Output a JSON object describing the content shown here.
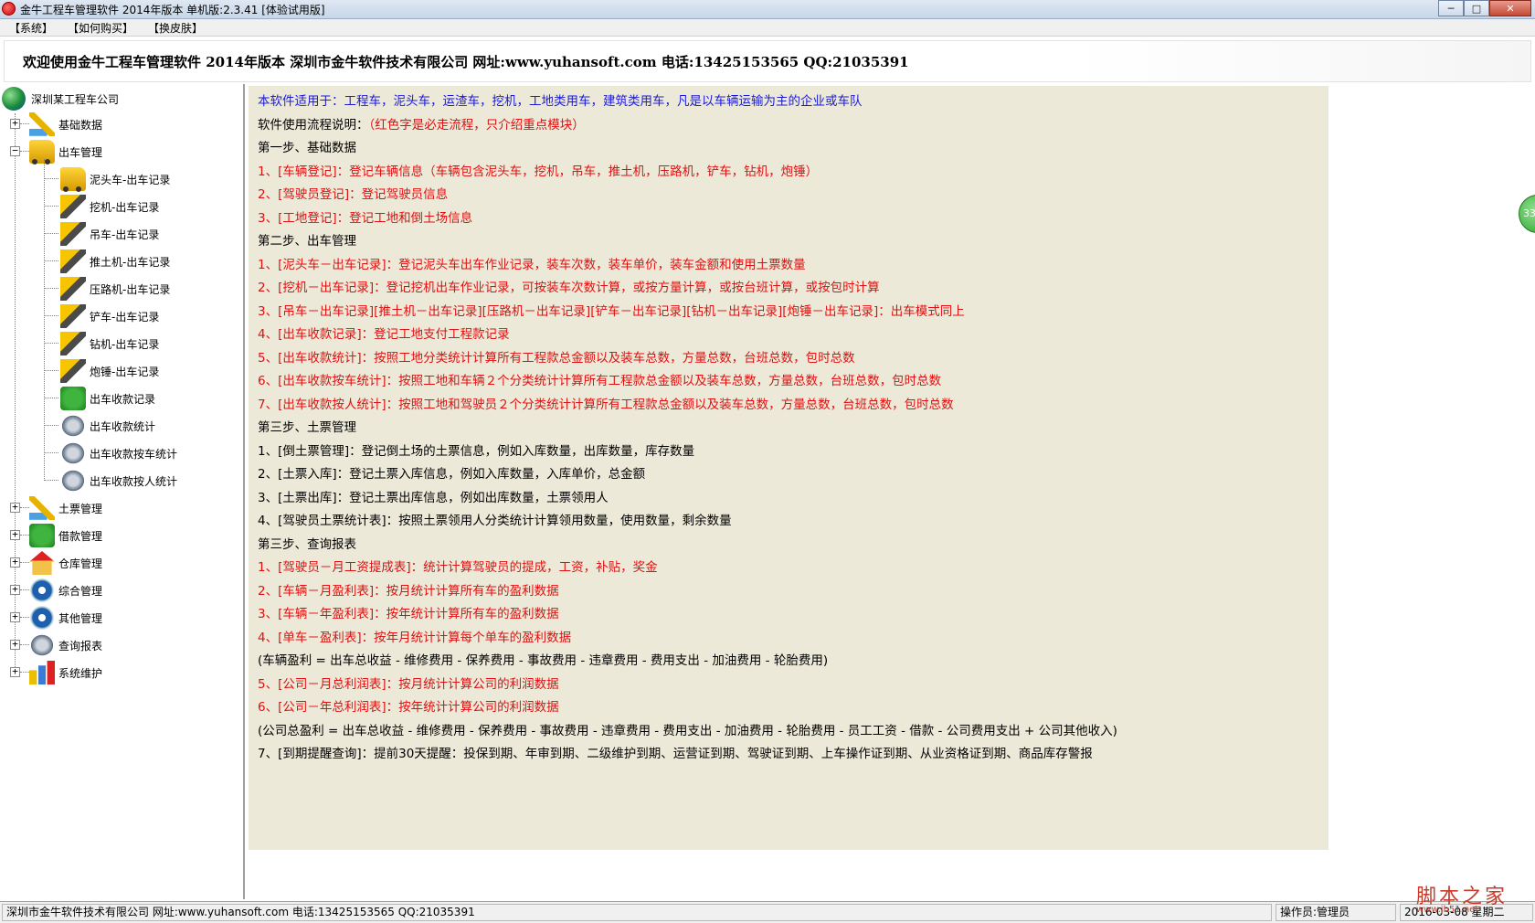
{
  "window": {
    "title": "金牛工程车管理软件 2014年版本 单机版:2.3.41 [体验试用版]",
    "controls": {
      "minimize": "─",
      "maximize": "□",
      "close": "✕"
    }
  },
  "menu": [
    "【系统】",
    "【如何购买】",
    "【换皮肤】"
  ],
  "banner": "欢迎使用金牛工程车管理软件 2014年版本 深圳市金牛软件技术有限公司 网址:www.yuhansoft.com 电话:13425153565 QQ:21035391",
  "tree": {
    "root": "深圳某工程车公司",
    "top_groups_before": [
      {
        "label": "基础数据",
        "expander": "+",
        "icon": "pen-icon"
      },
      {
        "label": "出车管理",
        "expander": "−",
        "icon": "truck-icon"
      }
    ],
    "children": [
      {
        "label": "泥头车-出车记录",
        "icon": "dump-truck-icon"
      },
      {
        "label": "挖机-出车记录",
        "icon": "excavator-icon"
      },
      {
        "label": "吊车-出车记录",
        "icon": "crane-icon"
      },
      {
        "label": "推土机-出车记录",
        "icon": "bulldozer-icon"
      },
      {
        "label": "压路机-出车记录",
        "icon": "roller-icon"
      },
      {
        "label": "铲车-出车记录",
        "icon": "loader-icon"
      },
      {
        "label": "钻机-出车记录",
        "icon": "drill-icon"
      },
      {
        "label": "炮锤-出车记录",
        "icon": "hammer-icon"
      },
      {
        "label": "出车收款记录",
        "icon": "money-icon"
      },
      {
        "label": "出车收款统计",
        "icon": "dish-icon"
      },
      {
        "label": "出车收款按车统计",
        "icon": "dish-icon"
      },
      {
        "label": "出车收款按人统计",
        "icon": "dish-icon"
      }
    ],
    "top_groups_after": [
      {
        "label": "土票管理",
        "expander": "+",
        "icon": "pen-icon"
      },
      {
        "label": "借款管理",
        "expander": "+",
        "icon": "money-icon"
      },
      {
        "label": "仓库管理",
        "expander": "+",
        "icon": "house-icon"
      },
      {
        "label": "综合管理",
        "expander": "+",
        "icon": "gear-icon"
      },
      {
        "label": "其他管理",
        "expander": "+",
        "icon": "gear-icon"
      },
      {
        "label": "查询报表",
        "expander": "+",
        "icon": "dish-icon"
      },
      {
        "label": "系统维护",
        "expander": "+",
        "icon": "chart-icon"
      }
    ]
  },
  "notes": [
    {
      "text": "本软件适用于：工程车，泥头车，运渣车，挖机，工地类用车，建筑类用车，凡是以车辆运输为主的企业或车队",
      "color": "blue"
    },
    {
      "text": "软件使用流程说明：（红色字是必走流程，只介绍重点模块）",
      "color": "mixed"
    },
    {
      "text": "第一步、基础数据",
      "color": "black"
    },
    {
      "text": "1、[车辆登记]：登记车辆信息（车辆包含泥头车，挖机，吊车，推土机，压路机，铲车，钻机，炮锤）",
      "color": "red"
    },
    {
      "text": "2、[驾驶员登记]：登记驾驶员信息",
      "color": "red"
    },
    {
      "text": "3、[工地登记]：登记工地和倒土场信息",
      "color": "red"
    },
    {
      "text": "第二步、出车管理",
      "color": "black"
    },
    {
      "text": "1、[泥头车－出车记录]：登记泥头车出车作业记录，装车次数，装车单价，装车金额和使用土票数量",
      "color": "red"
    },
    {
      "text": "2、[挖机－出车记录]：登记挖机出车作业记录，可按装车次数计算，或按方量计算，或按台班计算，或按包时计算",
      "color": "red"
    },
    {
      "text": "3、[吊车－出车记录][推土机－出车记录][压路机－出车记录][铲车－出车记录][钻机－出车记录][炮锤－出车记录]：出车模式同上",
      "color": "red"
    },
    {
      "text": "4、[出车收款记录]：登记工地支付工程款记录",
      "color": "red"
    },
    {
      "text": "5、[出车收款统计]：按照工地分类统计计算所有工程款总金额以及装车总数，方量总数，台班总数，包时总数",
      "color": "red"
    },
    {
      "text": "6、[出车收款按车统计]：按照工地和车辆２个分类统计计算所有工程款总金额以及装车总数，方量总数，台班总数，包时总数",
      "color": "red"
    },
    {
      "text": "7、[出车收款按人统计]：按照工地和驾驶员２个分类统计计算所有工程款总金额以及装车总数，方量总数，台班总数，包时总数",
      "color": "red"
    },
    {
      "text": "第三步、土票管理",
      "color": "black"
    },
    {
      "text": "1、[倒土票管理]：登记倒土场的土票信息，例如入库数量，出库数量，库存数量",
      "color": "black"
    },
    {
      "text": "2、[土票入库]：登记土票入库信息，例如入库数量，入库单价，总金额",
      "color": "black"
    },
    {
      "text": "3、[土票出库]：登记土票出库信息，例如出库数量，土票领用人",
      "color": "black"
    },
    {
      "text": "4、[驾驶员土票统计表]：按照土票领用人分类统计计算领用数量，使用数量，剩余数量",
      "color": "black"
    },
    {
      "text": "第三步、查询报表",
      "color": "black"
    },
    {
      "text": "1、[驾驶员－月工资提成表]：统计计算驾驶员的提成，工资，补贴，奖金",
      "color": "red"
    },
    {
      "text": "2、[车辆－月盈利表]：按月统计计算所有车的盈利数据",
      "color": "red"
    },
    {
      "text": "3、[车辆－年盈利表]：按年统计计算所有车的盈利数据",
      "color": "red"
    },
    {
      "text": "4、[单车－盈利表]：按年月统计计算每个单车的盈利数据",
      "color": "red"
    },
    {
      "text": "(车辆盈利 = 出车总收益 - 维修费用 - 保养费用 - 事故费用 - 违章费用 - 费用支出 - 加油费用  - 轮胎费用)",
      "color": "black"
    },
    {
      "text": "5、[公司－月总利润表]：按月统计计算公司的利润数据",
      "color": "red"
    },
    {
      "text": "6、[公司－年总利润表]：按年统计计算公司的利润数据",
      "color": "red"
    },
    {
      "text": "(公司总盈利 = 出车总收益 - 维修费用 - 保养费用 - 事故费用 - 违章费用 - 费用支出 - 加油费用  - 轮胎费用 - 员工工资 - 借款 - 公司费用支出 + 公司其他收入)",
      "color": "black"
    },
    {
      "text": "7、[到期提醒查询]：提前30天提醒：投保到期、年审到期、二级维护到期、运营证到期、驾驶证到期、上车操作证到期、从业资格证到期、商品库存警报",
      "color": "black"
    }
  ],
  "notes_line2": {
    "prefix": "软件使用流程说明：",
    "suffix": "（红色字是必走流程，只介绍重点模块）"
  },
  "float_badge": "33",
  "status": {
    "company": "深圳市金牛软件技术有限公司 网址:www.yuhansoft.com 电话:13425153565 QQ:21035391",
    "operator": "操作员:管理员",
    "date": "2016-03-08 星期二"
  },
  "watermark": {
    "text": "脚本之家",
    "sub": "www.jb51.net"
  },
  "colors": {
    "blue": "#1a1adb",
    "red": "#e01010",
    "notes_bg": "#ece9d8"
  }
}
